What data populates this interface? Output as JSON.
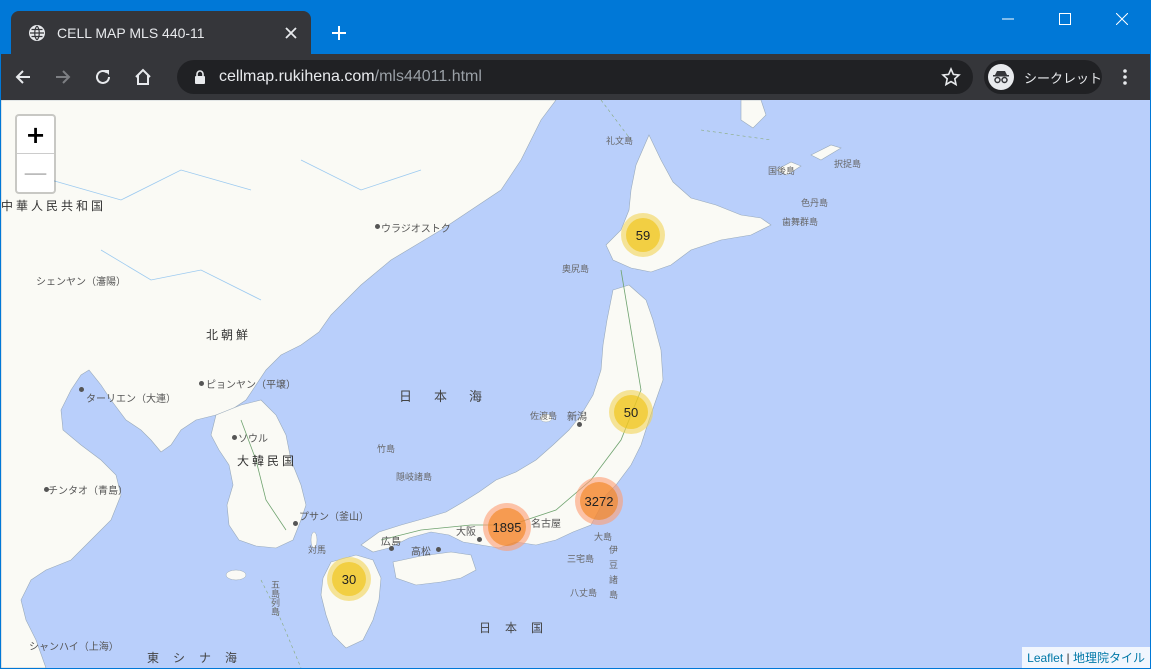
{
  "browser": {
    "tab_title": "CELL MAP MLS 440-11",
    "url_host": "cellmap.rukihena.com",
    "url_path": "/mls44011.html",
    "incognito_label": "シークレット"
  },
  "map": {
    "zoom_in": "+",
    "zoom_out": "—",
    "clusters": [
      {
        "count": "59",
        "size": "medium"
      },
      {
        "count": "50",
        "size": "medium"
      },
      {
        "count": "3272",
        "size": "large"
      },
      {
        "count": "1895",
        "size": "large"
      },
      {
        "count": "30",
        "size": "medium"
      }
    ],
    "labels": {
      "china": "中華人民共和国",
      "vladivostok": "ウラジオストク",
      "shenyang": "シェンヤン（瀋陽）",
      "north_korea": "北朝鮮",
      "pyongyang": "ピョンヤン（平壌）",
      "dalian": "ターリエン（大連）",
      "seoul": "ソウル",
      "south_korea": "大韓民国",
      "qingdao": "チンタオ（青島）",
      "busan": "プサン（釜山）",
      "shanghai": "シャンハイ（上海）",
      "sea_of_japan": "日本海",
      "east_china_sea": "東シナ海",
      "japan": "日本国",
      "rebun": "礼文島",
      "kunashiri": "国後島",
      "etorofu": "択捉島",
      "shikotan": "色丹島",
      "habomai": "歯舞群島",
      "okushiri": "奥尻島",
      "sado": "佐渡島",
      "niigata": "新潟",
      "takeshima": "竹島",
      "oki": "隠岐諸島",
      "tsushima": "対馬",
      "hiroshima": "広島",
      "takamatsu": "高松",
      "osaka": "大阪",
      "nagoya": "名古屋",
      "oshima": "大島",
      "miyake": "三宅島",
      "hachijo": "八丈島",
      "izu": "伊豆諸島",
      "goto": "五島列島"
    },
    "attribution_leaflet": "Leaflet",
    "attribution_sep": " | ",
    "attribution_tiles": "地理院タイル"
  }
}
